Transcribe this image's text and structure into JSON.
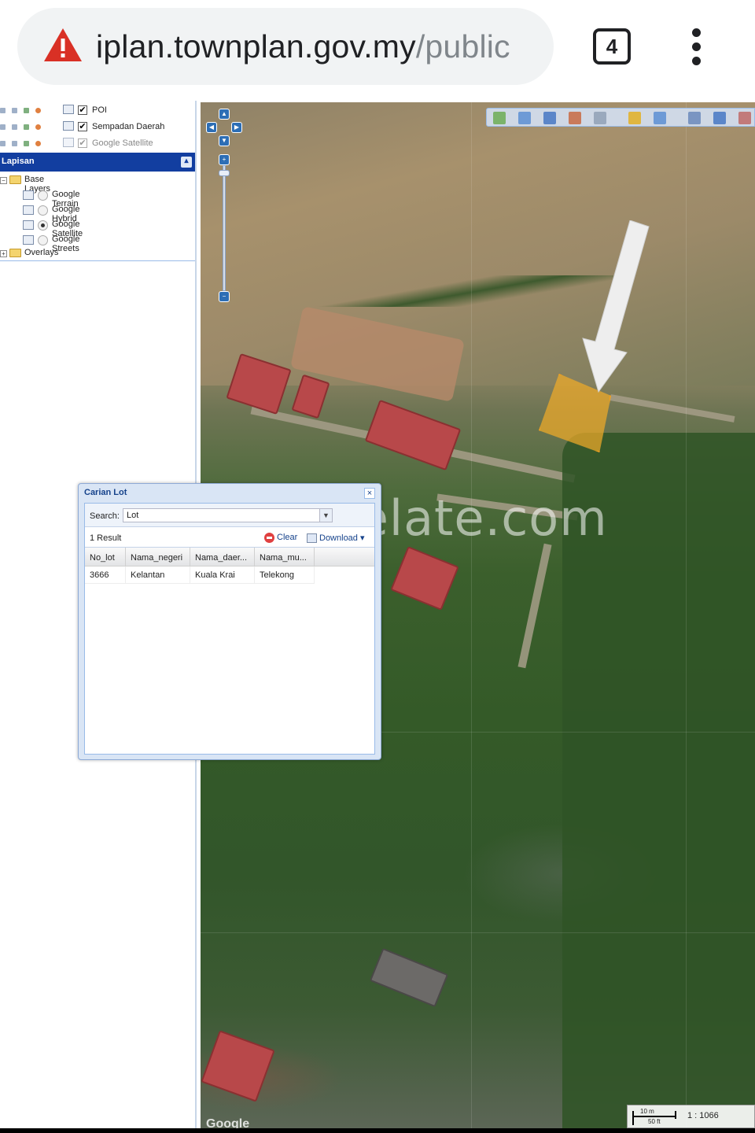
{
  "browser": {
    "url_host": "iplan.townplan.gov.my",
    "url_path": "/public",
    "tab_count": "4",
    "warning_icon": "warning-triangle-icon",
    "colors": {
      "warning": "#d93025",
      "text": "#202124",
      "path": "#80868b"
    }
  },
  "layers_top": [
    {
      "label": "POI",
      "checked": "✔"
    },
    {
      "label": "Sempadan Daerah",
      "checked": "✔"
    },
    {
      "label": "Google Satellite",
      "checked": "✔"
    }
  ],
  "lapisan": {
    "title": "Lapisan",
    "base_layers": "Base Layers",
    "items": [
      {
        "label": "Google Terrain"
      },
      {
        "label": "Google Hybrid"
      },
      {
        "label": "Google Satellite"
      },
      {
        "label": "Google Streets"
      }
    ],
    "overlays": "Overlays"
  },
  "dialog": {
    "title": "Carian Lot",
    "close": "×",
    "search_label": "Search:",
    "search_value": "Lot",
    "result_count": "1 Result",
    "clear_label": "Clear",
    "download_label": "Download ▾",
    "columns": [
      "No_lot",
      "Nama_negeri",
      "Nama_daer...",
      "Nama_mu..."
    ],
    "rows": [
      [
        "3666",
        "Kelantan",
        "Kuala Krai",
        "Telekong"
      ]
    ]
  },
  "map": {
    "watermark": "rumahlelate.com",
    "scale_m": "10 m",
    "scale_ft": "50 ft",
    "scale_ratio": "1 : 1066",
    "attribution": "Google",
    "highlight_color": "#f0aa28"
  }
}
